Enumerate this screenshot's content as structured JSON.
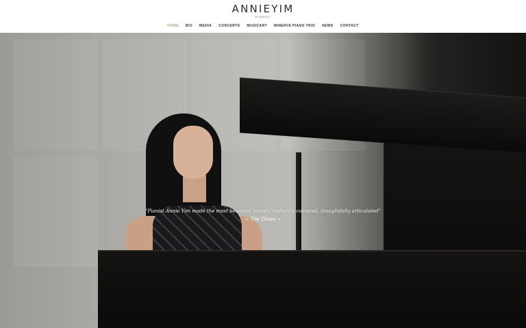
{
  "header": {
    "logo_name": "ANNIEYIM",
    "logo_sub": "PIANIST"
  },
  "nav": {
    "items": [
      {
        "label": "HOME",
        "active": true
      },
      {
        "label": "BIO"
      },
      {
        "label": "MEDIA"
      },
      {
        "label": "CONCERTS"
      },
      {
        "label": "MUSICART"
      },
      {
        "label": "MINERVA PIANO TRIO"
      },
      {
        "label": "NEWS"
      },
      {
        "label": "CONTACT"
      }
    ]
  },
  "hero": {
    "quote": "“Pianist Annie Yim made the most beautiful sounds, radiantly coloured, thoughtfully articulated”",
    "source": "~ The Times ~"
  },
  "colors": {
    "accent": "#c49a6c",
    "nav_text": "#333333",
    "logo_text": "#2b2b2b"
  }
}
